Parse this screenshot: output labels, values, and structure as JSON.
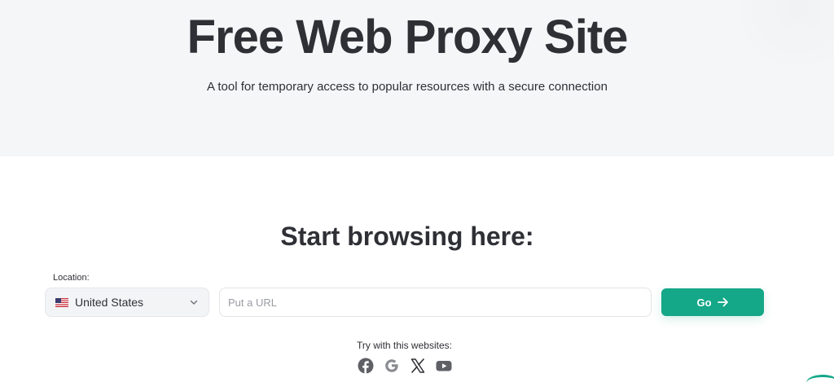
{
  "hero": {
    "title": "Free Web Proxy Site",
    "subtitle": "A tool for temporary access to popular resources with a secure connection"
  },
  "form": {
    "heading": "Start browsing here:",
    "location_label": "Location:",
    "location_value": "United States",
    "location_flag_icon": "us-flag-icon",
    "url_placeholder": "Put a URL",
    "url_value": "",
    "go_label": "Go"
  },
  "quick_sites": {
    "label": "Try with this websites:",
    "icons": [
      "facebook-icon",
      "google-icon",
      "x-icon",
      "youtube-icon"
    ]
  },
  "colors": {
    "accent": "#14a788",
    "hero_bg": "#f5f6f8",
    "text": "#2f3035"
  }
}
